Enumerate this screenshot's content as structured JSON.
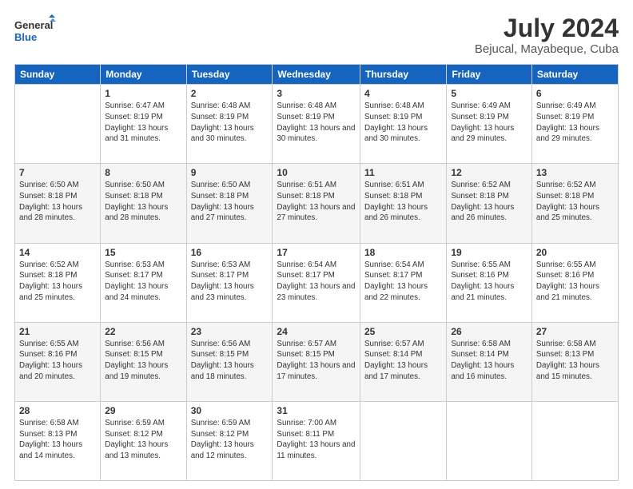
{
  "logo": {
    "line1": "General",
    "line2": "Blue"
  },
  "header": {
    "title": "July 2024",
    "subtitle": "Bejucal, Mayabeque, Cuba"
  },
  "weekdays": [
    "Sunday",
    "Monday",
    "Tuesday",
    "Wednesday",
    "Thursday",
    "Friday",
    "Saturday"
  ],
  "weeks": [
    [
      {
        "day": "",
        "info": ""
      },
      {
        "day": "1",
        "info": "Sunrise: 6:47 AM\nSunset: 8:19 PM\nDaylight: 13 hours and 31 minutes."
      },
      {
        "day": "2",
        "info": "Sunrise: 6:48 AM\nSunset: 8:19 PM\nDaylight: 13 hours and 30 minutes."
      },
      {
        "day": "3",
        "info": "Sunrise: 6:48 AM\nSunset: 8:19 PM\nDaylight: 13 hours and 30 minutes."
      },
      {
        "day": "4",
        "info": "Sunrise: 6:48 AM\nSunset: 8:19 PM\nDaylight: 13 hours and 30 minutes."
      },
      {
        "day": "5",
        "info": "Sunrise: 6:49 AM\nSunset: 8:19 PM\nDaylight: 13 hours and 29 minutes."
      },
      {
        "day": "6",
        "info": "Sunrise: 6:49 AM\nSunset: 8:19 PM\nDaylight: 13 hours and 29 minutes."
      }
    ],
    [
      {
        "day": "7",
        "info": "Sunrise: 6:50 AM\nSunset: 8:18 PM\nDaylight: 13 hours and 28 minutes."
      },
      {
        "day": "8",
        "info": "Sunrise: 6:50 AM\nSunset: 8:18 PM\nDaylight: 13 hours and 28 minutes."
      },
      {
        "day": "9",
        "info": "Sunrise: 6:50 AM\nSunset: 8:18 PM\nDaylight: 13 hours and 27 minutes."
      },
      {
        "day": "10",
        "info": "Sunrise: 6:51 AM\nSunset: 8:18 PM\nDaylight: 13 hours and 27 minutes."
      },
      {
        "day": "11",
        "info": "Sunrise: 6:51 AM\nSunset: 8:18 PM\nDaylight: 13 hours and 26 minutes."
      },
      {
        "day": "12",
        "info": "Sunrise: 6:52 AM\nSunset: 8:18 PM\nDaylight: 13 hours and 26 minutes."
      },
      {
        "day": "13",
        "info": "Sunrise: 6:52 AM\nSunset: 8:18 PM\nDaylight: 13 hours and 25 minutes."
      }
    ],
    [
      {
        "day": "14",
        "info": "Sunrise: 6:52 AM\nSunset: 8:18 PM\nDaylight: 13 hours and 25 minutes."
      },
      {
        "day": "15",
        "info": "Sunrise: 6:53 AM\nSunset: 8:17 PM\nDaylight: 13 hours and 24 minutes."
      },
      {
        "day": "16",
        "info": "Sunrise: 6:53 AM\nSunset: 8:17 PM\nDaylight: 13 hours and 23 minutes."
      },
      {
        "day": "17",
        "info": "Sunrise: 6:54 AM\nSunset: 8:17 PM\nDaylight: 13 hours and 23 minutes."
      },
      {
        "day": "18",
        "info": "Sunrise: 6:54 AM\nSunset: 8:17 PM\nDaylight: 13 hours and 22 minutes."
      },
      {
        "day": "19",
        "info": "Sunrise: 6:55 AM\nSunset: 8:16 PM\nDaylight: 13 hours and 21 minutes."
      },
      {
        "day": "20",
        "info": "Sunrise: 6:55 AM\nSunset: 8:16 PM\nDaylight: 13 hours and 21 minutes."
      }
    ],
    [
      {
        "day": "21",
        "info": "Sunrise: 6:55 AM\nSunset: 8:16 PM\nDaylight: 13 hours and 20 minutes."
      },
      {
        "day": "22",
        "info": "Sunrise: 6:56 AM\nSunset: 8:15 PM\nDaylight: 13 hours and 19 minutes."
      },
      {
        "day": "23",
        "info": "Sunrise: 6:56 AM\nSunset: 8:15 PM\nDaylight: 13 hours and 18 minutes."
      },
      {
        "day": "24",
        "info": "Sunrise: 6:57 AM\nSunset: 8:15 PM\nDaylight: 13 hours and 17 minutes."
      },
      {
        "day": "25",
        "info": "Sunrise: 6:57 AM\nSunset: 8:14 PM\nDaylight: 13 hours and 17 minutes."
      },
      {
        "day": "26",
        "info": "Sunrise: 6:58 AM\nSunset: 8:14 PM\nDaylight: 13 hours and 16 minutes."
      },
      {
        "day": "27",
        "info": "Sunrise: 6:58 AM\nSunset: 8:13 PM\nDaylight: 13 hours and 15 minutes."
      }
    ],
    [
      {
        "day": "28",
        "info": "Sunrise: 6:58 AM\nSunset: 8:13 PM\nDaylight: 13 hours and 14 minutes."
      },
      {
        "day": "29",
        "info": "Sunrise: 6:59 AM\nSunset: 8:12 PM\nDaylight: 13 hours and 13 minutes."
      },
      {
        "day": "30",
        "info": "Sunrise: 6:59 AM\nSunset: 8:12 PM\nDaylight: 13 hours and 12 minutes."
      },
      {
        "day": "31",
        "info": "Sunrise: 7:00 AM\nSunset: 8:11 PM\nDaylight: 13 hours and 11 minutes."
      },
      {
        "day": "",
        "info": ""
      },
      {
        "day": "",
        "info": ""
      },
      {
        "day": "",
        "info": ""
      }
    ]
  ]
}
